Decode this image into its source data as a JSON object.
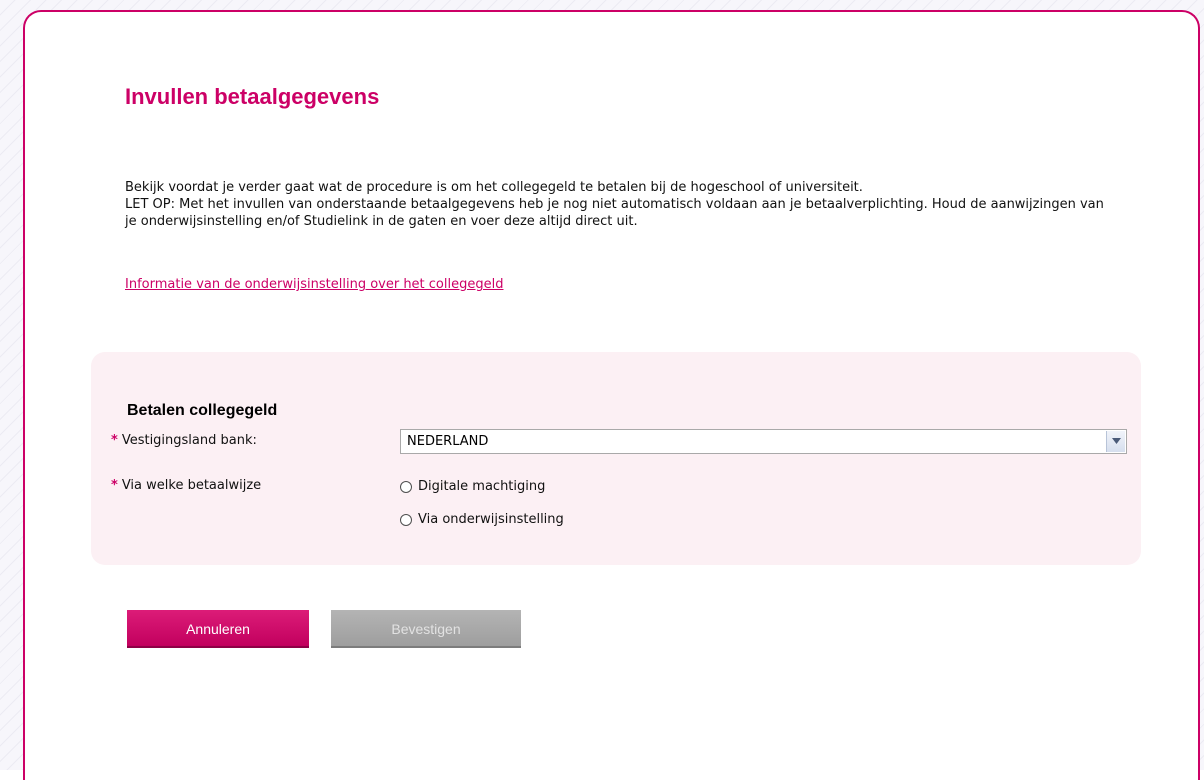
{
  "page": {
    "title": "Invullen betaalgegevens",
    "intro_line1": "Bekijk voordat je verder gaat wat de procedure is om het collegegeld te betalen bij de hogeschool of universiteit.",
    "intro_line2": "LET OP: Met het invullen van onderstaande betaalgegevens heb je nog niet automatisch voldaan aan je betaalverplichting. Houd de aanwijzingen van je onderwijsinstelling en/of Studielink in de gaten en voer deze altijd direct uit.",
    "info_link": "Informatie van de onderwijsinstelling over het collegegeld"
  },
  "form": {
    "section_title": "Betalen collegegeld",
    "required_marker": "*",
    "country_label": "Vestigingsland bank:",
    "country_value": "NEDERLAND",
    "method_label": "Via welke betaalwijze",
    "options": [
      {
        "label": "Digitale machtiging",
        "selected": false
      },
      {
        "label": "Via onderwijsinstelling",
        "selected": false
      }
    ]
  },
  "buttons": {
    "cancel": "Annuleren",
    "confirm": "Bevestigen",
    "confirm_disabled": true
  },
  "colors": {
    "accent": "#cc0066",
    "panel_bg": "#fcf0f4",
    "disabled": "#a8a8a8"
  }
}
